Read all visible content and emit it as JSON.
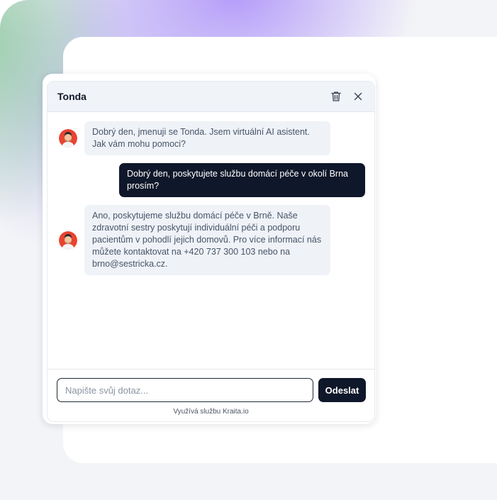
{
  "chat": {
    "title": "Tonda",
    "messages": [
      {
        "from": "bot",
        "text": "Dobrý den, jmenuji se Tonda. Jsem virtuální AI asistent. Jak vám mohu pomoci?"
      },
      {
        "from": "user",
        "text": "Dobrý den, poskytujete službu domácí péče v okolí Brna prosím?"
      },
      {
        "from": "bot",
        "text": "Ano, poskytujeme službu domácí péče v Brně. Naše zdravotní sestry poskytují individuální péči a podporu pacientům v pohodlí jejich domovů. Pro více informací nás můžete kontaktovat na +420 737 300 103 nebo na brno@sestricka.cz."
      }
    ],
    "input_placeholder": "Napište svůj dotaz...",
    "input_value": "",
    "send_label": "Odeslat",
    "powered_by": "Využívá službu Kraita.io"
  },
  "icons": {
    "header_delete": "trash-icon",
    "header_close": "close-icon",
    "bot_avatar": "assistant-avatar"
  },
  "colors": {
    "user_bubble": "#0f172a",
    "bot_bubble": "#eff2f7",
    "avatar_bg": "#e8442f",
    "header_bg": "#f0f3f8",
    "send_button": "#0f172a"
  }
}
